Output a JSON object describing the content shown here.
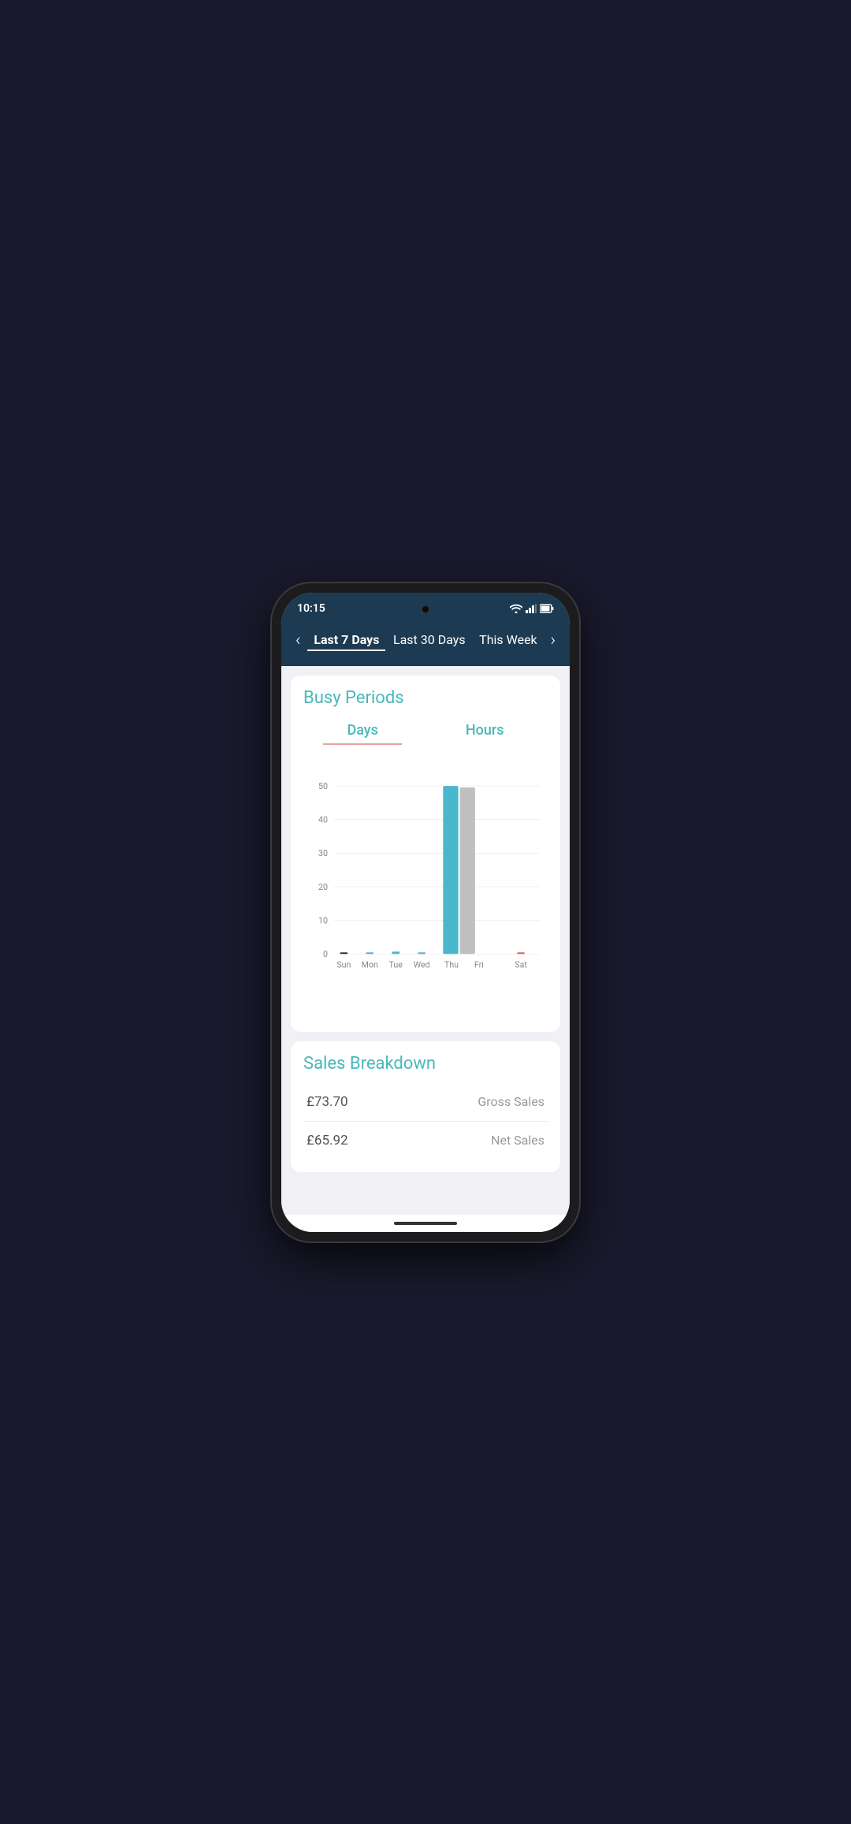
{
  "status": {
    "time": "10:15"
  },
  "nav": {
    "tabs": [
      {
        "label": "Last 7 Days",
        "active": true
      },
      {
        "label": "Last 30 Days",
        "active": false
      },
      {
        "label": "This Week",
        "active": false
      }
    ],
    "left_arrow": "‹",
    "right_arrow": "›"
  },
  "busy_periods": {
    "title": "Busy Periods",
    "chart_tabs": [
      {
        "label": "Days",
        "active": true
      },
      {
        "label": "Hours",
        "active": false
      }
    ],
    "y_axis": [
      50,
      40,
      30,
      20,
      10,
      0
    ],
    "x_axis": [
      "Sun",
      "Mon",
      "Tue",
      "Wed",
      "Thu",
      "Fri",
      "Sat"
    ],
    "bars": [
      {
        "day": "Sun",
        "value": 0.5,
        "color": "#1a3a52"
      },
      {
        "day": "Mon",
        "value": 0.5,
        "color": "#4ab8cc"
      },
      {
        "day": "Tue",
        "value": 0.5,
        "color": "#4ab8cc"
      },
      {
        "day": "Wed",
        "value": 0.5,
        "color": "#4ab8cc"
      },
      {
        "day": "Thu",
        "value": 50,
        "color": "#4ab8cc"
      },
      {
        "day": "Fri",
        "value": 49,
        "color": "#c8c8c8"
      },
      {
        "day": "Sat",
        "value": 0.3,
        "color": "#e06060"
      }
    ]
  },
  "sales_breakdown": {
    "title": "Sales Breakdown",
    "rows": [
      {
        "value": "£73.70",
        "label": "Gross Sales"
      },
      {
        "value": "£65.92",
        "label": "Net Sales"
      }
    ]
  }
}
